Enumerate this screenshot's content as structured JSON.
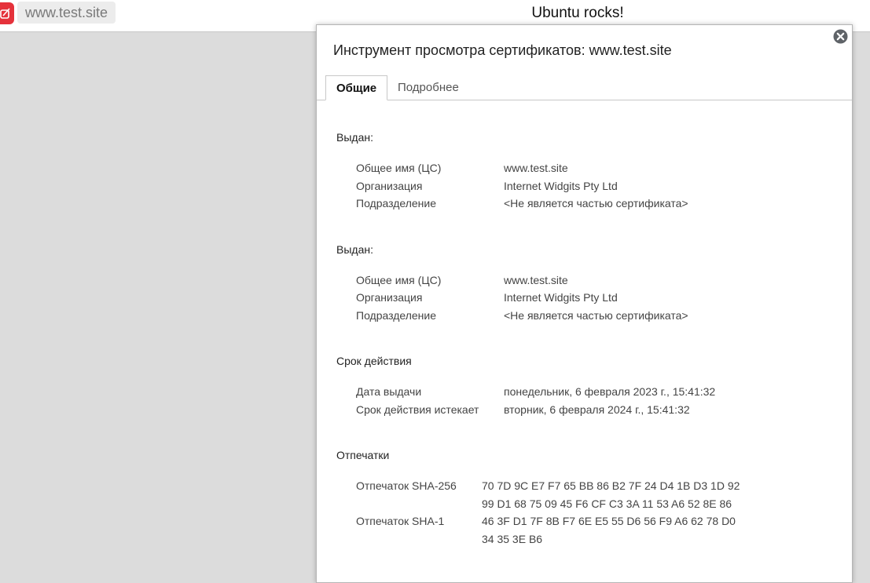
{
  "browser": {
    "url": "www.test.site",
    "page_title": "Ubuntu rocks!"
  },
  "viewer": {
    "title": "Инструмент просмотра сертификатов: www.test.site",
    "tabs": [
      "Общие",
      "Подробнее"
    ],
    "issued_to": {
      "heading": "Выдан:",
      "rows": [
        {
          "label": "Общее имя (ЦС)",
          "value": "www.test.site"
        },
        {
          "label": "Организация",
          "value": "Internet Widgits Pty Ltd"
        },
        {
          "label": "Подразделение",
          "value": "<Не является частью сертификата>"
        }
      ]
    },
    "issued_by": {
      "heading": "Выдан:",
      "rows": [
        {
          "label": "Общее имя (ЦС)",
          "value": "www.test.site"
        },
        {
          "label": "Организация",
          "value": "Internet Widgits Pty Ltd"
        },
        {
          "label": "Подразделение",
          "value": "<Не является частью сертификата>"
        }
      ]
    },
    "validity": {
      "heading": "Срок действия",
      "rows": [
        {
          "label": "Дата выдачи",
          "value": "понедельник, 6 февраля 2023 г., 15:41:32"
        },
        {
          "label": "Срок действия истекает",
          "value": "вторник, 6 февраля 2024 г., 15:41:32"
        }
      ]
    },
    "fingerprints": {
      "heading": "Отпечатки",
      "sha256_label": "Отпечаток SHA-256",
      "sha256_line1": "70 7D 9C E7 F7 65 BB 86 B2 7F 24 D4 1B D3 1D 92",
      "sha256_line2": "99 D1 68 75 09 45 F6 CF C3 3A 11 53 A6 52 8E 86",
      "sha1_label": "Отпечаток SHA-1",
      "sha1_line1": "46 3F D1 7F 8B F7 6E E5 55 D6 56 F9 A6 62 78 D0",
      "sha1_line2": "34 35 3E B6"
    }
  }
}
